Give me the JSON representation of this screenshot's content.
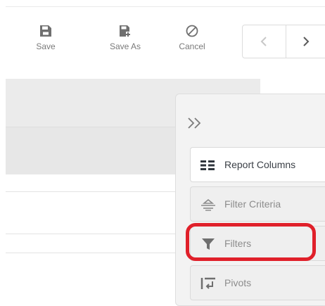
{
  "toolbar": {
    "save_label": "Save",
    "save_as_label": "Save As",
    "cancel_label": "Cancel"
  },
  "pager": {
    "prev_icon": "chevron-left-icon",
    "next_icon": "chevron-right-icon"
  },
  "side_panel": {
    "collapse_icon": "double-chevron-right-icon",
    "tabs": [
      {
        "label": "Report Columns",
        "icon": "columns-icon",
        "active": true
      },
      {
        "label": "Filter Criteria",
        "icon": "filter-criteria-icon",
        "active": false
      },
      {
        "label": "Filters",
        "icon": "funnel-icon",
        "active": false
      },
      {
        "label": "Pivots",
        "icon": "pivot-icon",
        "active": false
      }
    ]
  },
  "colors": {
    "highlight": "#e0202a",
    "active_text": "#3a3f46",
    "muted_text": "#8c8c8c"
  }
}
